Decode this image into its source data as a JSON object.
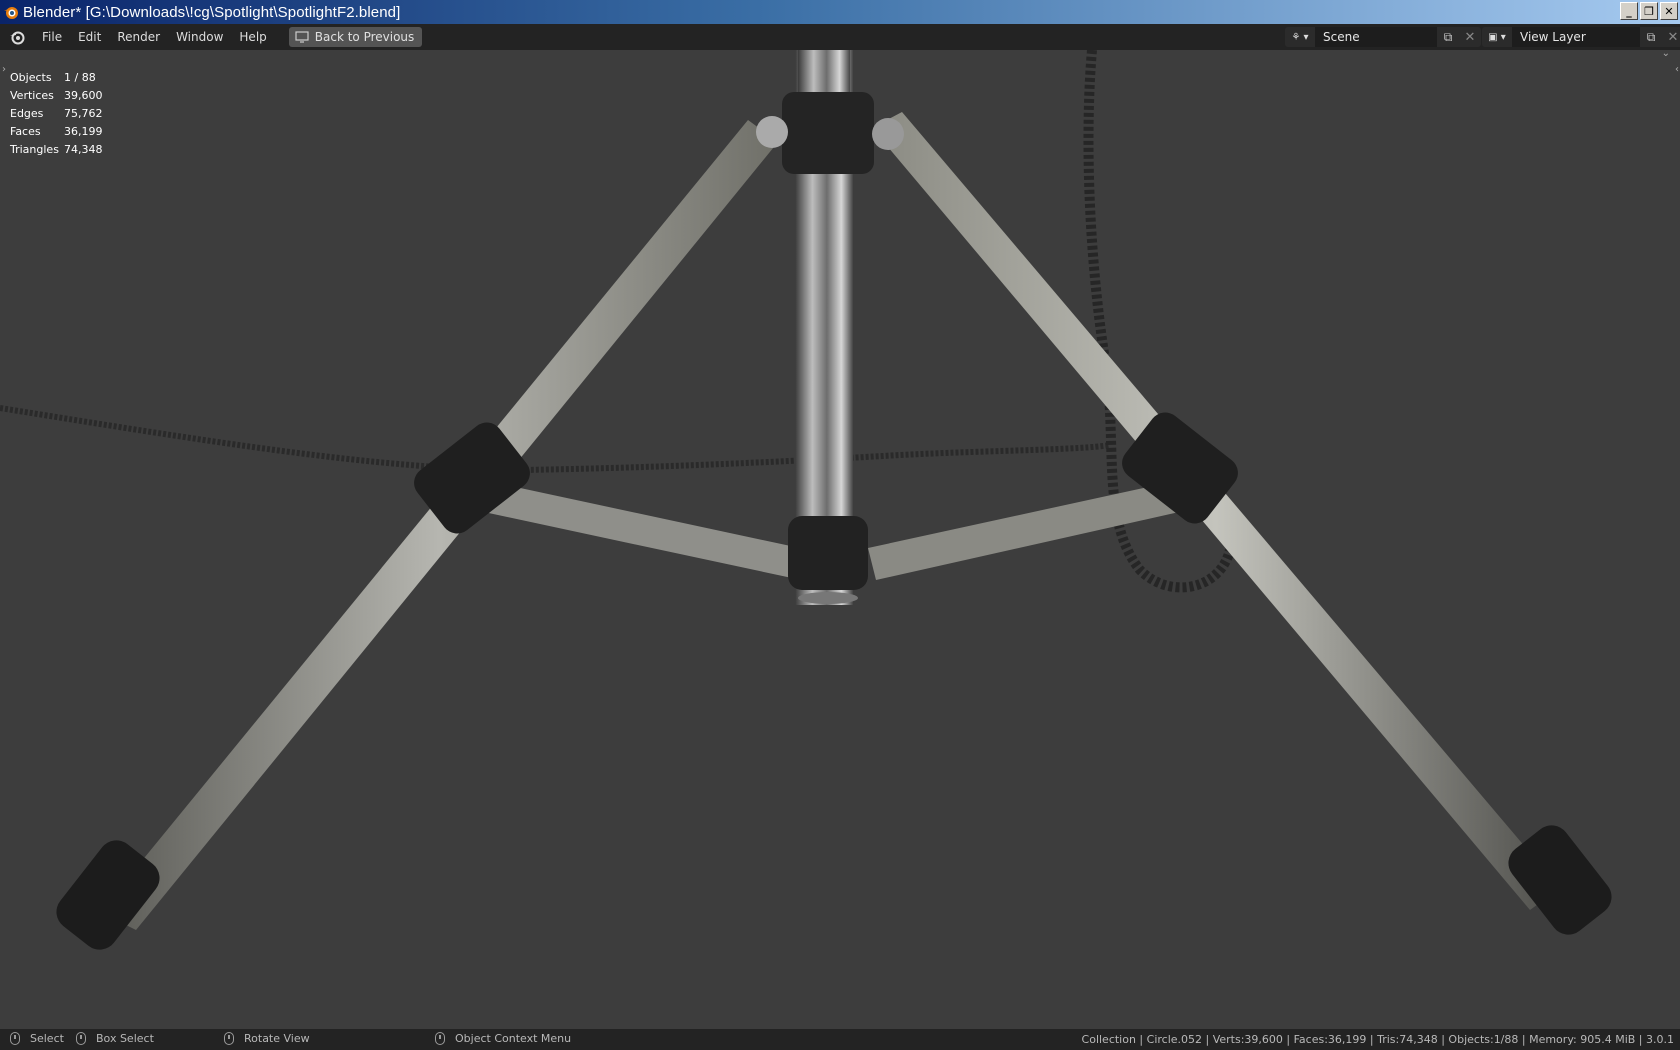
{
  "window": {
    "title": "Blender* [G:\\Downloads\\!cg\\Spotlight\\SpotlightF2.blend]",
    "buttons": {
      "minimize": "_",
      "maximize": "❐",
      "close": "✕"
    }
  },
  "menu": {
    "items": [
      "File",
      "Edit",
      "Render",
      "Window",
      "Help"
    ],
    "back_button": "Back to Previous"
  },
  "scene": {
    "name": "Scene",
    "view_layer": "View Layer"
  },
  "stats": [
    {
      "label": "Objects",
      "value": "1 / 88"
    },
    {
      "label": "Vertices",
      "value": "39,600"
    },
    {
      "label": "Edges",
      "value": "75,762"
    },
    {
      "label": "Faces",
      "value": "36,199"
    },
    {
      "label": "Triangles",
      "value": "74,348"
    }
  ],
  "statusbar": {
    "select": "Select",
    "box_select": "Box Select",
    "rotate_view": "Rotate View",
    "context_menu": "Object Context Menu",
    "info": "Collection | Circle.052 | Verts:39,600 | Faces:36,199 | Tris:74,348 | Objects:1/88 | Memory: 905.4 MiB | 3.0.1"
  },
  "colors": {
    "viewport_bg": "#3d3d3d",
    "header_bg": "#232323",
    "titlebar_start": "#0a246a",
    "titlebar_end": "#a6caf0",
    "accent": "#e87d0d"
  }
}
